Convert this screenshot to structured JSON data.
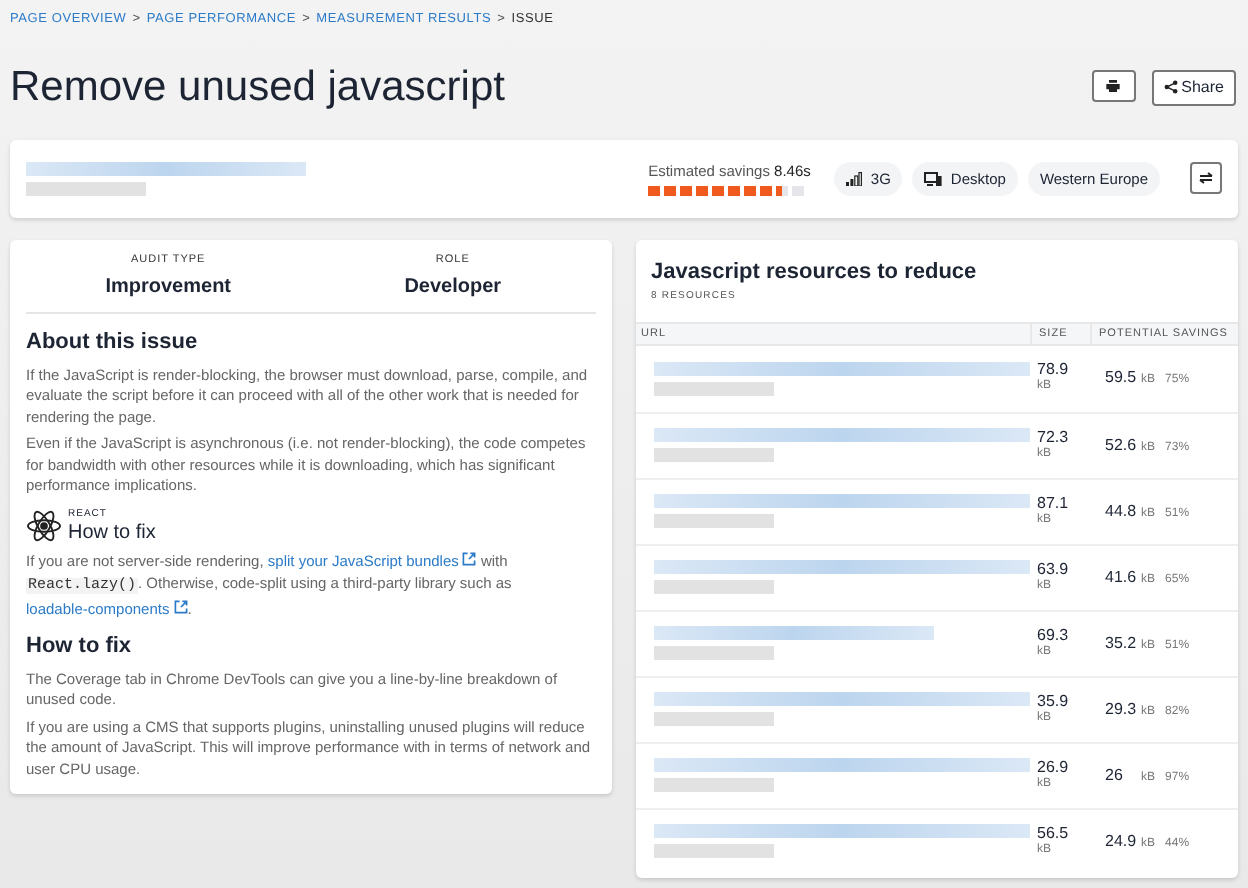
{
  "breadcrumb": [
    {
      "label": "PAGE OVERVIEW",
      "current": false
    },
    {
      "label": "PAGE PERFORMANCE",
      "current": false
    },
    {
      "label": "MEASUREMENT RESULTS",
      "current": false
    },
    {
      "label": "ISSUE",
      "current": true
    }
  ],
  "breadcrumb_separator": ">",
  "title": "Remove unused javascript",
  "actions": {
    "share": "Share"
  },
  "summary": {
    "savings_label": "Estimated savings",
    "savings_value": "8.46s",
    "connection": "3G",
    "device": "Desktop",
    "region": "Western Europe"
  },
  "audit": {
    "meta": [
      {
        "label": "AUDIT TYPE",
        "value": "Improvement"
      },
      {
        "label": "ROLE",
        "value": "Developer"
      }
    ],
    "about_heading": "About this issue",
    "about_paragraphs": [
      "If the JavaScript is render-blocking, the browser must download, parse, compile, and evaluate the script before it can proceed with all of the other work that is needed for rendering the page.",
      "Even if the JavaScript is asynchronous (i.e. not render-blocking), the code competes for bandwidth with other resources while it is downloading, which has significant performance implications."
    ],
    "framework_label": "REACT",
    "framework_heading": "How to fix",
    "framework_fix": {
      "before": "If you are not server-side rendering,",
      "link1": "split your JavaScript bundles",
      "middle": "with",
      "code": "React.lazy()",
      "after": ". Otherwise, code-split using a third-party library such as",
      "link2": "loadable-components",
      "end": "."
    },
    "fix_heading": "How to fix",
    "fix_paragraphs": [
      "The Coverage tab in Chrome DevTools can give you a line-by-line breakdown of unused code.",
      "If you are using a CMS that supports plugins, uninstalling unused plugins will reduce the amount of JavaScript. This will improve performance with in terms of network and user CPU usage."
    ]
  },
  "resources": {
    "title": "Javascript resources to reduce",
    "count": "8 RESOURCES",
    "columns": [
      "URL",
      "SIZE",
      "POTENTIAL SAVINGS"
    ],
    "rows": [
      {
        "size": "78.9",
        "size_unit": "kB",
        "savings": "59.5",
        "savings_unit": "kB",
        "percent": "75%"
      },
      {
        "size": "72.3",
        "size_unit": "kB",
        "savings": "52.6",
        "savings_unit": "kB",
        "percent": "73%"
      },
      {
        "size": "87.1",
        "size_unit": "kB",
        "savings": "44.8",
        "savings_unit": "kB",
        "percent": "51%"
      },
      {
        "size": "63.9",
        "size_unit": "kB",
        "savings": "41.6",
        "savings_unit": "kB",
        "percent": "65%"
      },
      {
        "size": "69.3",
        "size_unit": "kB",
        "savings": "35.2",
        "savings_unit": "kB",
        "percent": "51%"
      },
      {
        "size": "35.9",
        "size_unit": "kB",
        "savings": "29.3",
        "savings_unit": "kB",
        "percent": "82%"
      },
      {
        "size": "26.9",
        "size_unit": "kB",
        "savings": "26",
        "savings_unit": "kB",
        "percent": "97%"
      },
      {
        "size": "56.5",
        "size_unit": "kB",
        "savings": "24.9",
        "savings_unit": "kB",
        "percent": "44%"
      }
    ]
  }
}
